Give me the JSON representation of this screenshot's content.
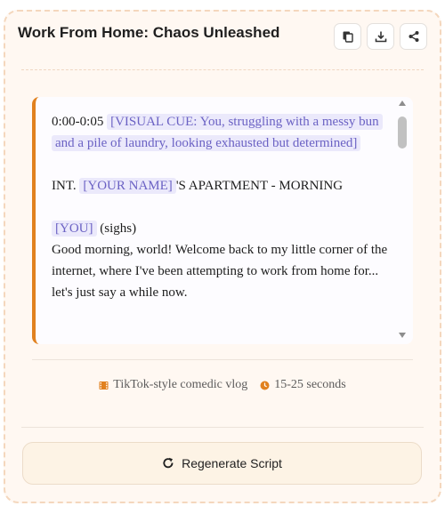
{
  "header": {
    "title": "Work From Home: Chaos Unleashed",
    "actions": [
      {
        "icon": "copy-icon"
      },
      {
        "icon": "download-icon"
      },
      {
        "icon": "share-icon"
      }
    ]
  },
  "script": {
    "scene1": {
      "timecode": "0:00-0:05",
      "visual_cue": "[VISUAL CUE: You, struggling with a messy bun and a pile of laundry, looking exhausted but determined]"
    },
    "scene_heading": {
      "prefix": "INT.",
      "name_tag": "[YOUR NAME]",
      "suffix": "'S APARTMENT - MORNING"
    },
    "dialogue": {
      "speaker_tag": "[YOU]",
      "direction": "(sighs)",
      "line": "Good morning, world! Welcome back to my little corner of the internet, where I've been attempting to work from home for... let's just say a while now."
    }
  },
  "meta": {
    "style_icon": "film-icon",
    "style": "TikTok-style comedic vlog",
    "duration_icon": "clock-icon",
    "duration": "15-25 seconds"
  },
  "regenerate": {
    "icon": "refresh-icon",
    "label": "Regenerate Script"
  },
  "colors": {
    "accent": "#e1811f",
    "tag_bg": "#ebe9fb",
    "tag_text": "#6b62c4",
    "card_bg": "#fff8f2"
  }
}
